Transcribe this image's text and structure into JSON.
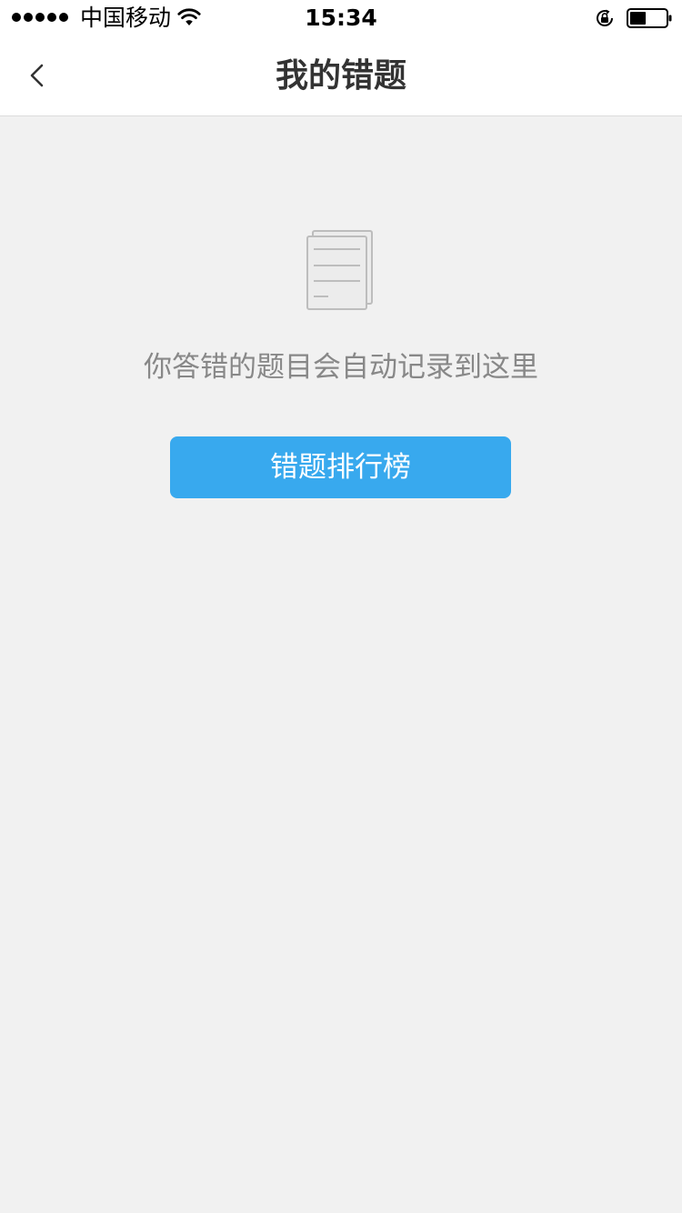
{
  "status_bar": {
    "carrier": "中国移动",
    "time": "15:34",
    "signal_strength": 5,
    "battery_level": 0.45,
    "icons": [
      "wifi-icon",
      "rotation-lock-icon",
      "battery-icon"
    ]
  },
  "nav_bar": {
    "title": "我的错题",
    "back_icon": "chevron-left-icon"
  },
  "empty_state": {
    "icon": "document-stack-icon",
    "message": "你答错的题目会自动记录到这里",
    "button_label": "错题排行榜"
  },
  "colors": {
    "accent": "#38a9ee",
    "background": "#f1f1f1",
    "title_text": "#333333",
    "muted_text": "#888888"
  }
}
